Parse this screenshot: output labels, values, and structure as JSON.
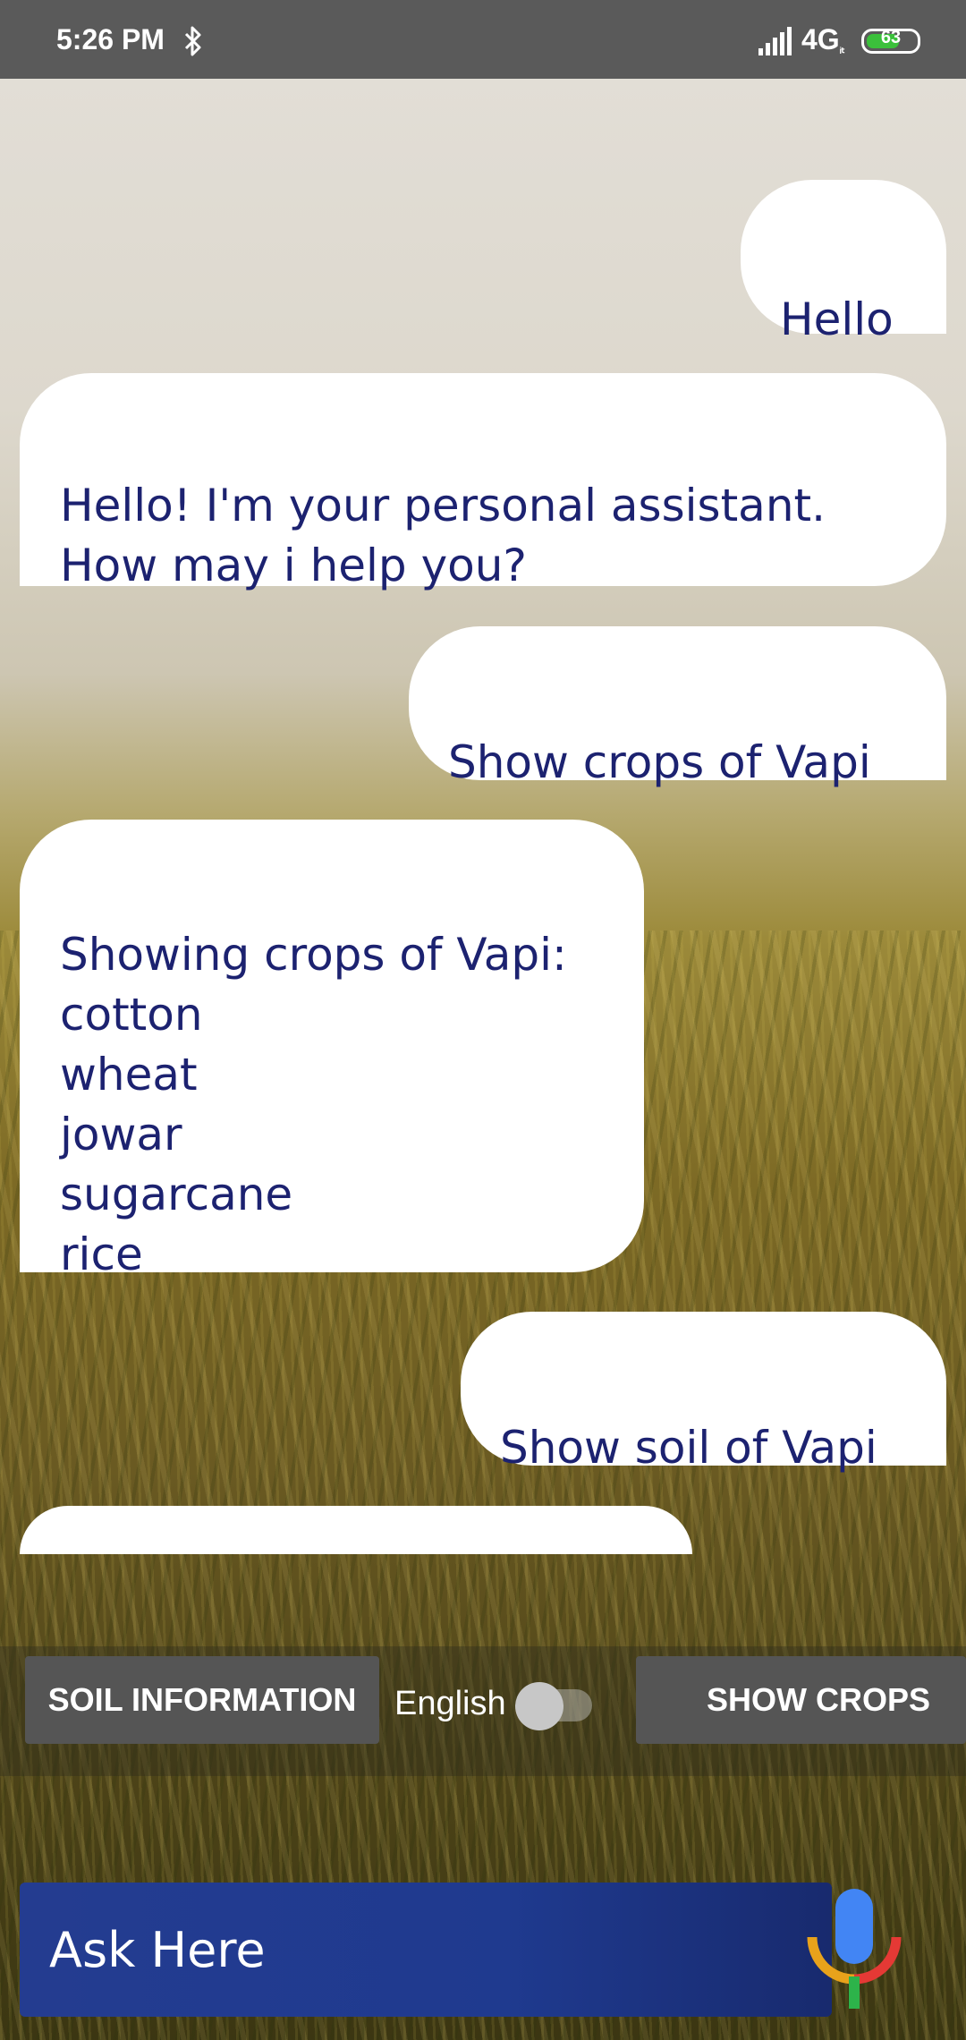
{
  "status_bar": {
    "time": "5:26 PM",
    "network": "4G",
    "network_sub": "ᵢₜ",
    "battery": "63",
    "icons": [
      "bluetooth-icon",
      "signal-icon",
      "battery-icon"
    ]
  },
  "messages": [
    {
      "from": "user",
      "text": "Hello"
    },
    {
      "from": "bot",
      "text": "Hello! I'm your personal assistant.\nHow may i help you?"
    },
    {
      "from": "user",
      "text": "Show crops of Vapi"
    },
    {
      "from": "bot",
      "text": "Showing crops of Vapi:\ncotton\nwheat\njowar\nsugarcane\nrice"
    },
    {
      "from": "user",
      "text": "Show soil of Vapi"
    },
    {
      "from": "bot",
      "text": ""
    }
  ],
  "actions": {
    "soil_label": "SOIL INFORMATION",
    "language_label": "English",
    "crops_label": "SHOW CROPS",
    "language_toggle_on": false
  },
  "input": {
    "placeholder": "Ask Here",
    "mic_icon": "mic-icon"
  },
  "colors": {
    "status_bar": "#5a5a5a",
    "bubble_text": "#1c2270",
    "bubble_bg": "#ffffff",
    "chip_bg": "#555555",
    "ask_bar": "#1f3a8f",
    "battery_green": "#3bc03b"
  }
}
